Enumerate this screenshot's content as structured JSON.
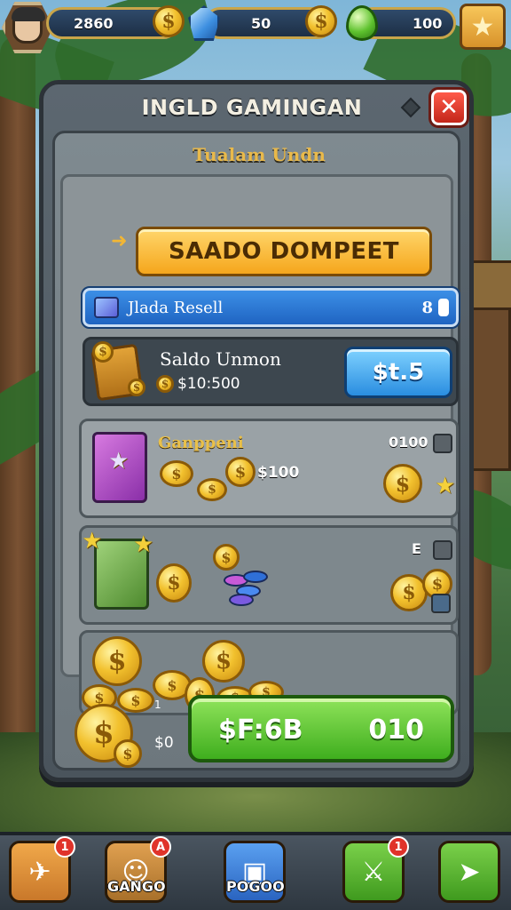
{
  "topbar": {
    "avatar_icon": "player-avatar",
    "gold": "2860",
    "gems": "50",
    "energy": "100",
    "star_icon": "star-icon"
  },
  "panel": {
    "title": "INGLD GAMINGAN",
    "subtitle": "Tualam Undn",
    "wallet_button": "SAADO DOMPEET",
    "info": {
      "label": "Jlada Resell",
      "value": "8"
    },
    "balance": {
      "label": "Saldo Unmon",
      "value": "$10:500",
      "button": "$t.5"
    },
    "offers": [
      {
        "title": "Ganppeni",
        "price": "$100",
        "tag": "0100"
      },
      {
        "title": "",
        "price": "",
        "tag": "E"
      },
      {
        "title": "",
        "price": "",
        "tag": ""
      }
    ],
    "buy": {
      "coin_value": "$0",
      "coin_mark": "1",
      "button_left": "$F:6B",
      "button_right": "010"
    }
  },
  "bottom_nav": [
    {
      "name": "nav-plane",
      "icon": "plane-icon",
      "label": "",
      "badge": "1",
      "color": "#d98a2c"
    },
    {
      "name": "nav-character",
      "icon": "character-icon",
      "label": "GANGO",
      "badge": "A",
      "color": "#c9823a"
    },
    {
      "name": "nav-inventory",
      "icon": "inventory-icon",
      "label": "POGOO",
      "badge": "",
      "color": "#3a7ad0"
    },
    {
      "name": "nav-upgrade",
      "icon": "sword-icon",
      "label": "",
      "badge": "1",
      "color": "#58b830"
    },
    {
      "name": "nav-send",
      "icon": "send-icon",
      "label": "",
      "badge": "",
      "color": "#58b830"
    }
  ]
}
